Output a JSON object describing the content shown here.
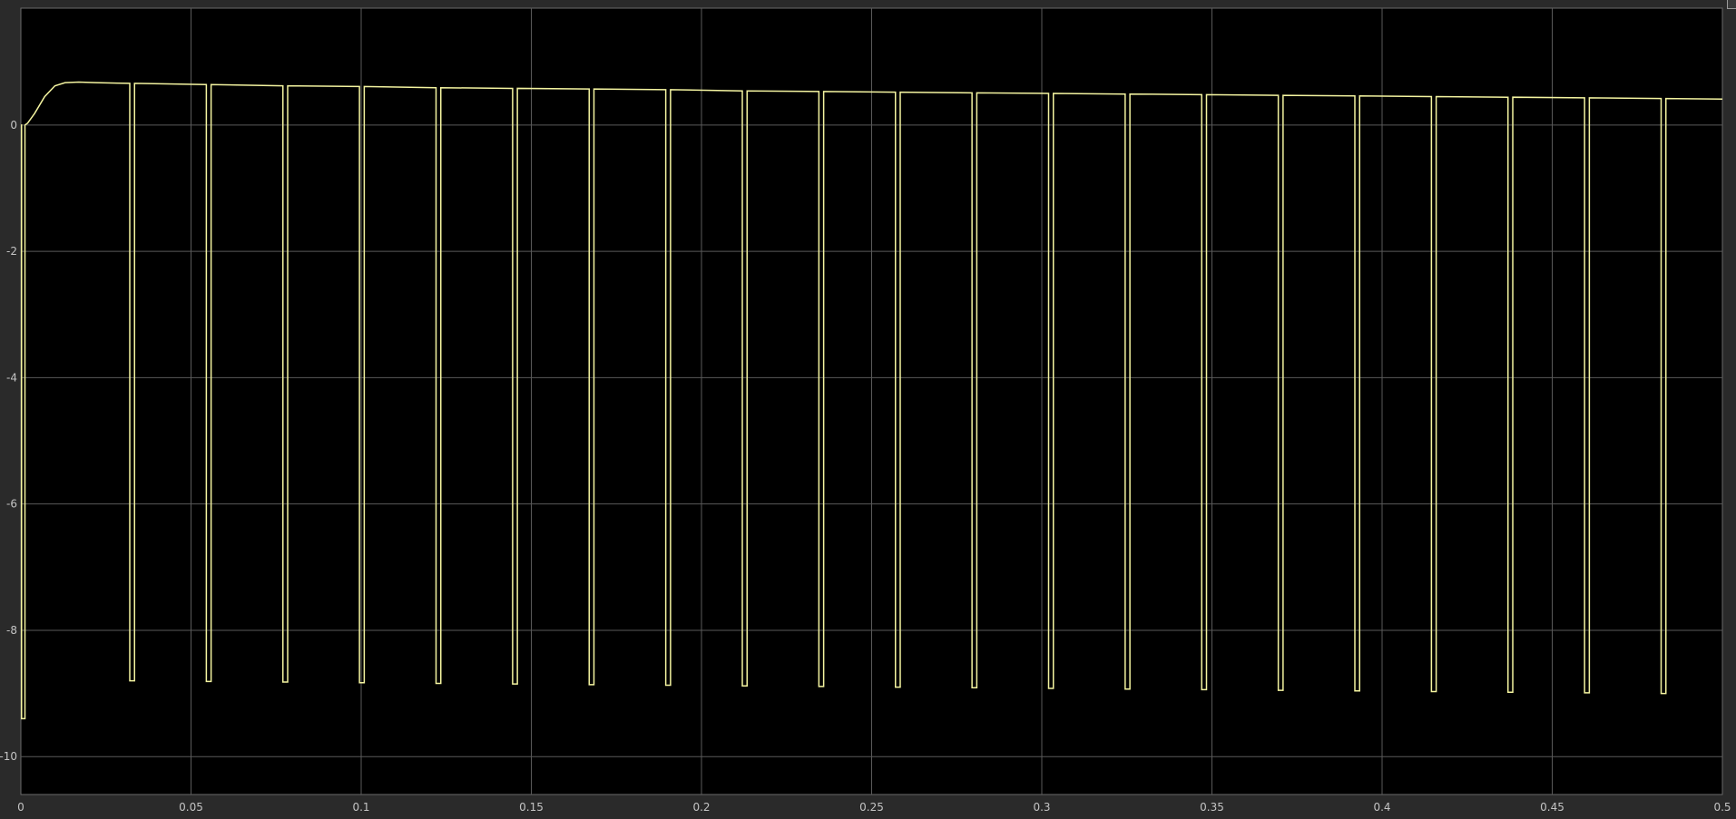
{
  "chart_data": {
    "type": "line",
    "title": "",
    "xlabel": "",
    "ylabel": "",
    "xlim": [
      0,
      0.5
    ],
    "ylim": [
      -10.6,
      1.85
    ],
    "grid": true,
    "background_color": "#000000",
    "figure_color": "#2a2a2a",
    "grid_color": "#5a5a5a",
    "tick_label_color": "#c4c4c4",
    "line_color": "#f4f4a0",
    "x_ticks": [
      {
        "value": 0,
        "label": "0"
      },
      {
        "value": 0.05,
        "label": "0.05"
      },
      {
        "value": 0.1,
        "label": "0.1"
      },
      {
        "value": 0.15,
        "label": "0.15"
      },
      {
        "value": 0.2,
        "label": "0.2"
      },
      {
        "value": 0.25,
        "label": "0.25"
      },
      {
        "value": 0.3,
        "label": "0.3"
      },
      {
        "value": 0.35,
        "label": "0.35"
      },
      {
        "value": 0.4,
        "label": "0.4"
      },
      {
        "value": 0.45,
        "label": "0.45"
      },
      {
        "value": 0.5,
        "label": "0.5"
      }
    ],
    "y_ticks": [
      {
        "value": 0,
        "label": "0"
      },
      {
        "value": -2,
        "label": "-2"
      },
      {
        "value": -4,
        "label": "-4"
      },
      {
        "value": -6,
        "label": "-6"
      },
      {
        "value": -8,
        "label": "-8"
      },
      {
        "value": -10,
        "label": "-10"
      }
    ],
    "series": [
      {
        "color": "#f4f4a0",
        "x": [
          0,
          0.0002,
          0.0002,
          0.0012,
          0.0012,
          0.002,
          0.004,
          0.007,
          0.01,
          0.013,
          0.017,
          0.022,
          0.032,
          0.032,
          0.0334,
          0.0334,
          0.0545,
          0.0545,
          0.0559,
          0.0559,
          0.077,
          0.077,
          0.0784,
          0.0784,
          0.0995,
          0.0995,
          0.1009,
          0.1009,
          0.122,
          0.122,
          0.1234,
          0.1234,
          0.1445,
          0.1445,
          0.1459,
          0.1459,
          0.167,
          0.167,
          0.1684,
          0.1684,
          0.1895,
          0.1895,
          0.1909,
          0.1909,
          0.212,
          0.212,
          0.2134,
          0.2134,
          0.2345,
          0.2345,
          0.2359,
          0.2359,
          0.257,
          0.257,
          0.2584,
          0.2584,
          0.2795,
          0.2795,
          0.2809,
          0.2809,
          0.302,
          0.302,
          0.3034,
          0.3034,
          0.3245,
          0.3245,
          0.3259,
          0.3259,
          0.347,
          0.347,
          0.3484,
          0.3484,
          0.3695,
          0.3695,
          0.3709,
          0.3709,
          0.392,
          0.392,
          0.3934,
          0.3934,
          0.4145,
          0.4145,
          0.4159,
          0.4159,
          0.437,
          0.437,
          0.4384,
          0.4384,
          0.4595,
          0.4595,
          0.4609,
          0.4609,
          0.482,
          0.482,
          0.4834,
          0.4834,
          0.5
        ],
        "y": [
          0,
          0,
          -9.4,
          -9.4,
          0,
          0.03,
          0.18,
          0.45,
          0.62,
          0.67,
          0.68,
          0.67,
          0.66,
          -8.8,
          -8.8,
          0.66,
          0.64,
          -8.81,
          -8.81,
          0.64,
          0.62,
          -8.82,
          -8.82,
          0.62,
          0.61,
          -8.83,
          -8.83,
          0.61,
          0.59,
          -8.84,
          -8.84,
          0.59,
          0.58,
          -8.85,
          -8.85,
          0.58,
          0.57,
          -8.86,
          -8.86,
          0.57,
          0.56,
          -8.87,
          -8.87,
          0.56,
          0.54,
          -8.88,
          -8.88,
          0.54,
          0.53,
          -8.89,
          -8.89,
          0.53,
          0.52,
          -8.9,
          -8.9,
          0.52,
          0.51,
          -8.91,
          -8.91,
          0.51,
          0.5,
          -8.92,
          -8.92,
          0.5,
          0.49,
          -8.93,
          -8.93,
          0.49,
          0.48,
          -8.94,
          -8.94,
          0.48,
          0.47,
          -8.95,
          -8.95,
          0.47,
          0.46,
          -8.96,
          -8.96,
          0.46,
          0.45,
          -8.97,
          -8.97,
          0.45,
          0.44,
          -8.98,
          -8.98,
          0.44,
          0.43,
          -8.99,
          -8.99,
          0.43,
          0.42,
          -9.0,
          -9.0,
          0.42,
          0.41
        ]
      }
    ]
  }
}
